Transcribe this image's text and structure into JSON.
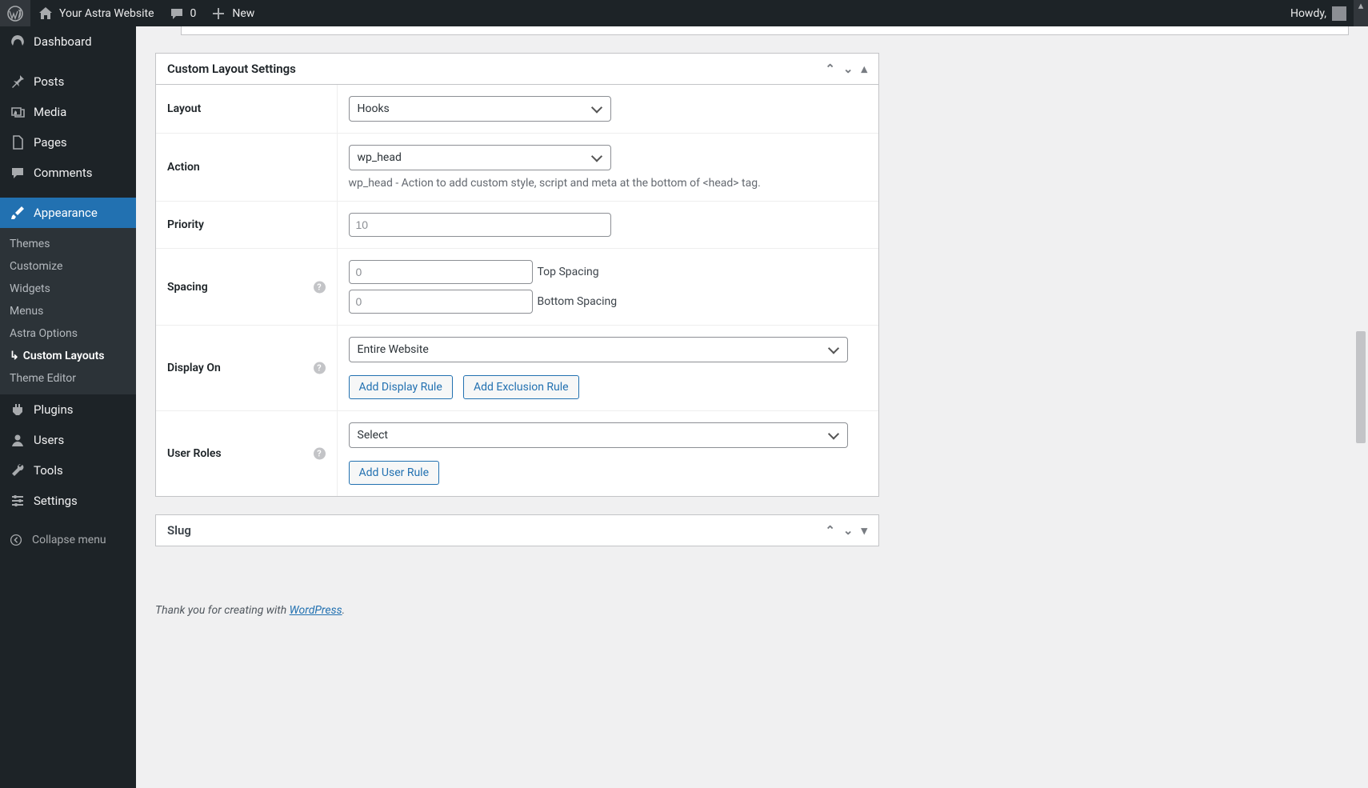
{
  "adminbar": {
    "site_title": "Your Astra Website",
    "comment_count": "0",
    "new_label": "New",
    "howdy": "Howdy,"
  },
  "sidebar": {
    "dashboard": "Dashboard",
    "posts": "Posts",
    "media": "Media",
    "pages": "Pages",
    "comments": "Comments",
    "appearance": "Appearance",
    "submenu": {
      "themes": "Themes",
      "customize": "Customize",
      "widgets": "Widgets",
      "menus": "Menus",
      "astra_options": "Astra Options",
      "custom_layouts": "Custom Layouts",
      "theme_editor": "Theme Editor"
    },
    "plugins": "Plugins",
    "users": "Users",
    "tools": "Tools",
    "settings": "Settings",
    "collapse": "Collapse menu"
  },
  "panel": {
    "title": "Custom Layout Settings",
    "fields": {
      "layout": {
        "label": "Layout",
        "value": "Hooks"
      },
      "action": {
        "label": "Action",
        "value": "wp_head",
        "desc": "wp_head - Action to add custom style, script and meta at the bottom of <head> tag."
      },
      "priority": {
        "label": "Priority",
        "placeholder": "10"
      },
      "spacing": {
        "label": "Spacing",
        "top_placeholder": "0",
        "top_label": "Top Spacing",
        "bottom_placeholder": "0",
        "bottom_label": "Bottom Spacing"
      },
      "display_on": {
        "label": "Display On",
        "value": "Entire Website",
        "add_display": "Add Display Rule",
        "add_exclusion": "Add Exclusion Rule"
      },
      "user_roles": {
        "label": "User Roles",
        "value": "Select",
        "add_user": "Add User Rule"
      }
    }
  },
  "slug": {
    "title": "Slug"
  },
  "footer": {
    "pre": "Thank you for creating with ",
    "link": "WordPress",
    "post": "."
  }
}
